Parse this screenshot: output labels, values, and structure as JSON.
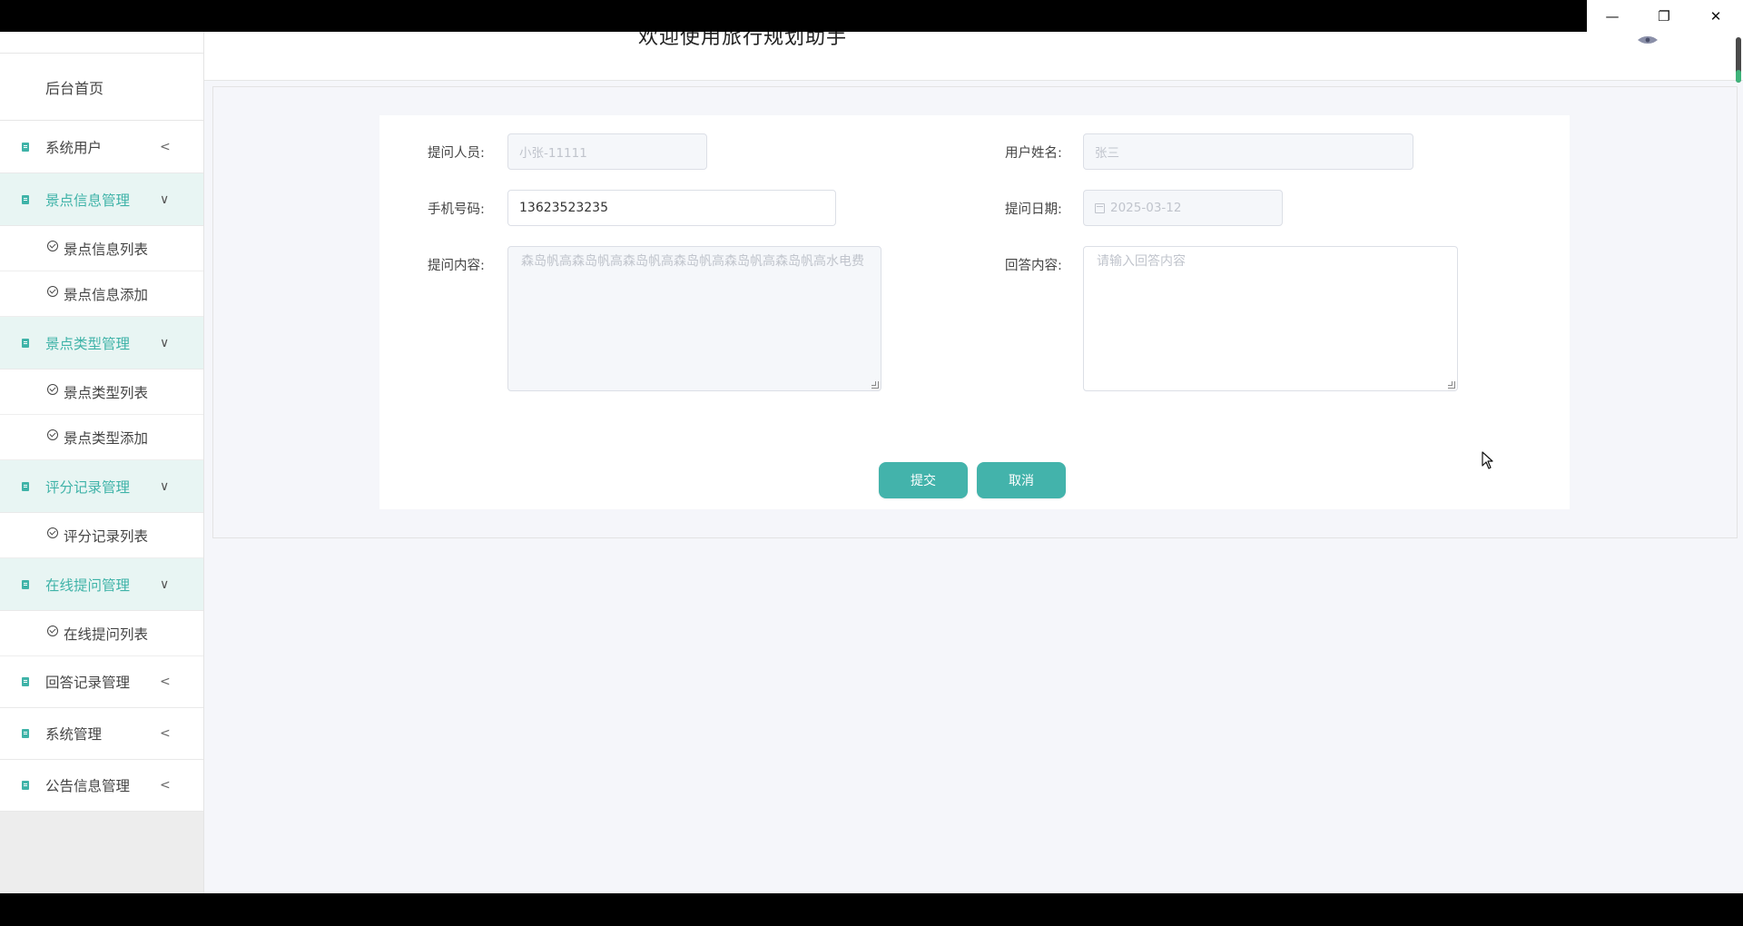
{
  "window": {
    "minimize_icon": "minimize-icon",
    "maximize_icon": "restore-icon",
    "close_icon": "close-icon",
    "min_glyph": "—",
    "max_glyph": "❐",
    "close_glyph": "✕"
  },
  "header": {
    "title": "欢迎使用旅行规划助手"
  },
  "sidebar": {
    "home": "后台首页",
    "items": [
      {
        "label": "系统用户",
        "open": false,
        "arrow": "<"
      },
      {
        "label": "景点信息管理",
        "open": true,
        "arrow": "∨",
        "children": [
          "景点信息列表",
          "景点信息添加"
        ]
      },
      {
        "label": "景点类型管理",
        "open": true,
        "arrow": "∨",
        "children": [
          "景点类型列表",
          "景点类型添加"
        ]
      },
      {
        "label": "评分记录管理",
        "open": true,
        "arrow": "∨",
        "children": [
          "评分记录列表"
        ]
      },
      {
        "label": "在线提问管理",
        "open": true,
        "arrow": "∨",
        "children": [
          "在线提问列表"
        ]
      },
      {
        "label": "回答记录管理",
        "open": false,
        "arrow": "<"
      },
      {
        "label": "系统管理",
        "open": false,
        "arrow": "<"
      },
      {
        "label": "公告信息管理",
        "open": false,
        "arrow": "<"
      }
    ]
  },
  "form": {
    "asker_label": "提问人员:",
    "asker_value": "小张-11111",
    "username_label": "用户姓名:",
    "username_value": "张三",
    "phone_label": "手机号码:",
    "phone_value": "13623523235",
    "date_label": "提问日期:",
    "date_value": "2025-03-12",
    "question_label": "提问内容:",
    "question_value": "森岛帆高森岛帆高森岛帆高森岛帆高森岛帆高森岛帆高水电费",
    "answer_label": "回答内容:",
    "answer_placeholder": "请输入回答内容",
    "submit_label": "提交",
    "cancel_label": "取消"
  },
  "colors": {
    "accent": "#43b3ab",
    "menu_open_bg": "#e8f5f3",
    "menu_open_text": "#3fb3a8"
  }
}
